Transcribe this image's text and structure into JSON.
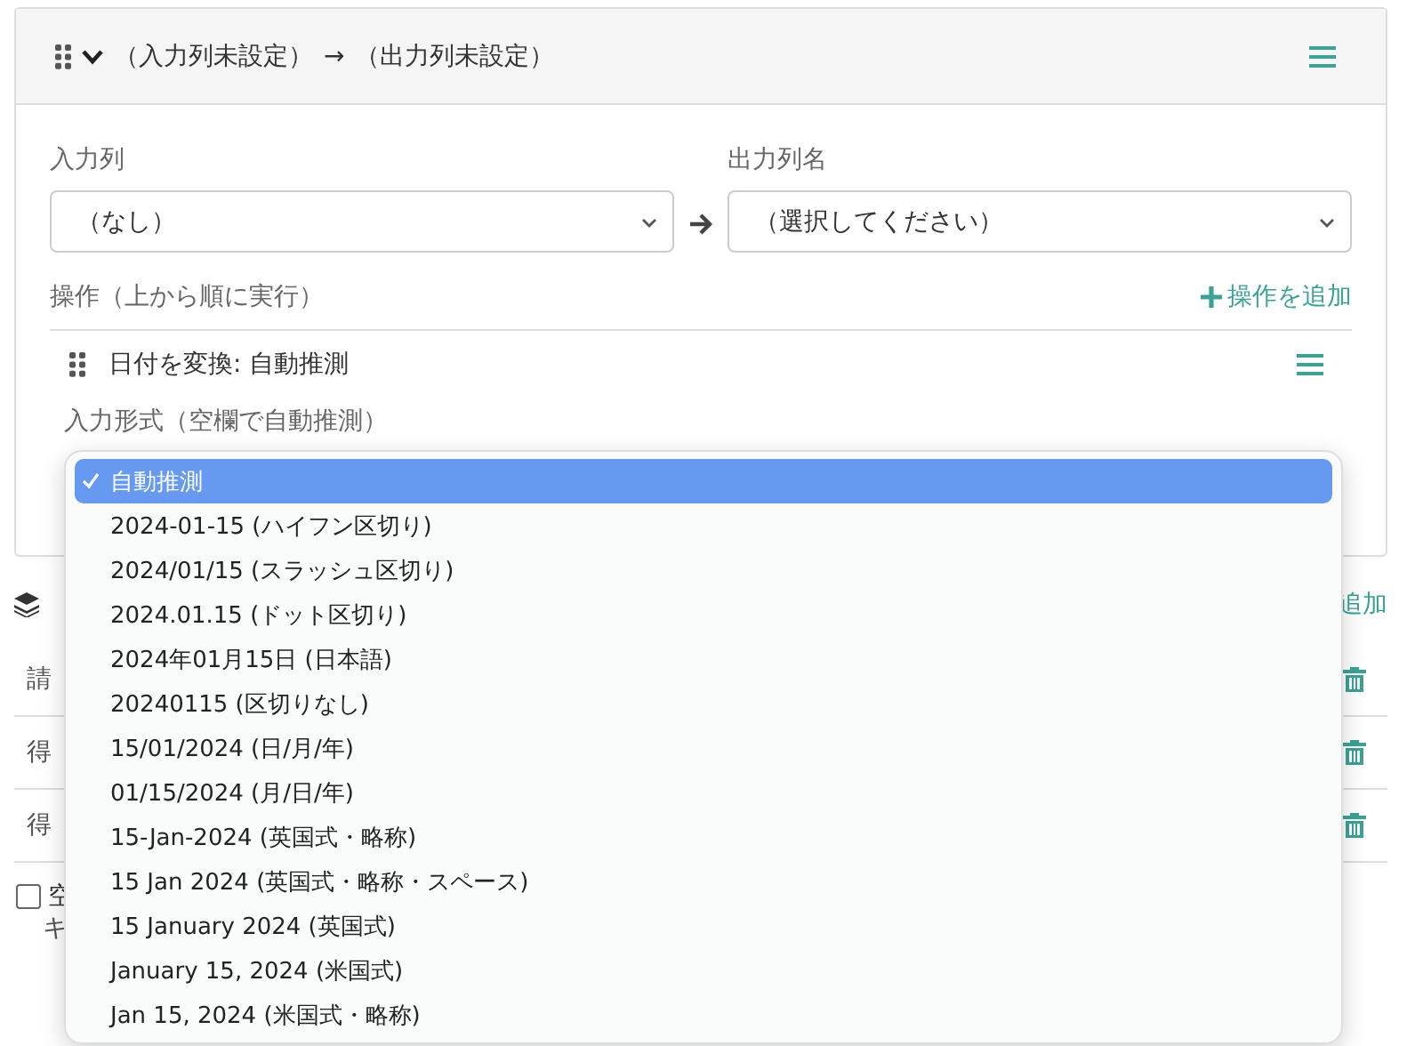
{
  "header": {
    "expanded": true,
    "input_label": "（入力列未設定）",
    "arrow": "→",
    "output_label": "（出力列未設定）"
  },
  "input_column": {
    "label": "入力列",
    "value": "（なし）"
  },
  "output_column": {
    "label": "出力列名",
    "value": "（選択してください）"
  },
  "operations": {
    "label": "操作（上から順に実行）",
    "add_button": "操作を追加",
    "items": [
      {
        "title": "日付を変換: 自動推測",
        "field_label": "入力形式（空欄で自動推測）"
      }
    ]
  },
  "dropdown": {
    "options": [
      {
        "label": "自動推測",
        "selected": true
      },
      {
        "label": "2024-01-15 (ハイフン区切り)",
        "selected": false
      },
      {
        "label": "2024/01/15 (スラッシュ区切り)",
        "selected": false
      },
      {
        "label": "2024.01.15 (ドット区切り)",
        "selected": false
      },
      {
        "label": "2024年01月15日 (日本語)",
        "selected": false
      },
      {
        "label": "20240115 (区切りなし)",
        "selected": false
      },
      {
        "label": "15/01/2024 (日/月/年)",
        "selected": false
      },
      {
        "label": "01/15/2024 (月/日/年)",
        "selected": false
      },
      {
        "label": "15-Jan-2024 (英国式・略称)",
        "selected": false
      },
      {
        "label": "15 Jan 2024 (英国式・略称・スペース)",
        "selected": false
      },
      {
        "label": "15 January 2024 (英国式)",
        "selected": false
      },
      {
        "label": "January 15, 2024 (米国式)",
        "selected": false
      },
      {
        "label": "Jan 15, 2024 (米国式・略称)",
        "selected": false
      }
    ]
  },
  "section": {
    "add_button": "追加",
    "rows": [
      {
        "label": "請"
      },
      {
        "label": "得"
      },
      {
        "label": "得"
      }
    ],
    "checkbox": {
      "label": "空",
      "checked": false
    },
    "note": "キ"
  }
}
